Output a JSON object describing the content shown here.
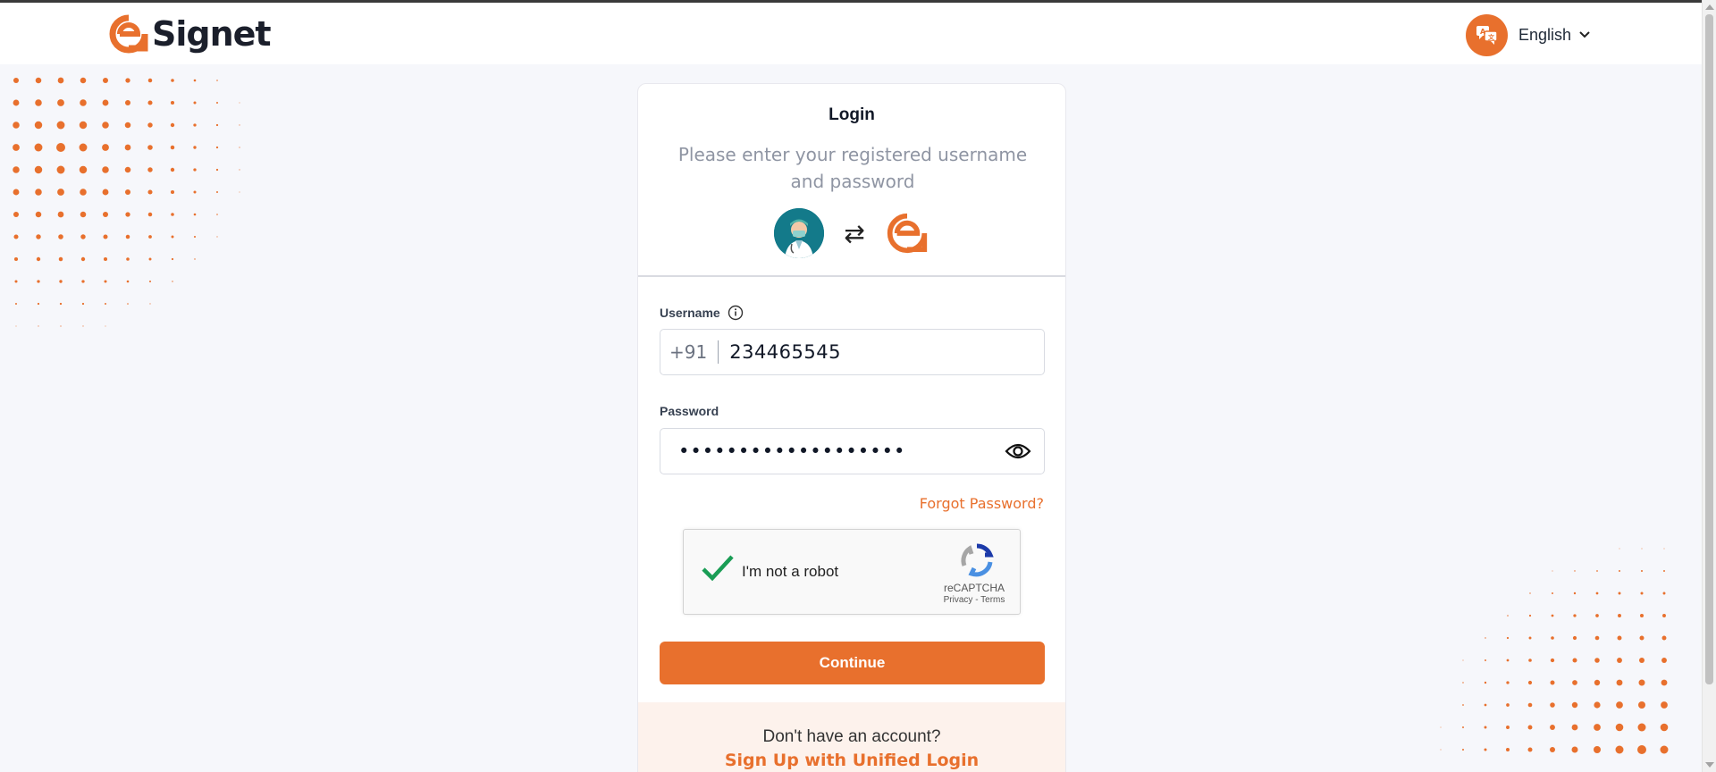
{
  "header": {
    "brand_name": "Signet",
    "language": {
      "label": "English"
    }
  },
  "login": {
    "title": "Login",
    "subtitle": "Please enter your registered username and password",
    "swap_symbol": "⇄",
    "username": {
      "label": "Username",
      "country_code": "+91",
      "value": "234465545"
    },
    "password": {
      "label": "Password",
      "masked_value": "•••••••••••••••••••"
    },
    "forgot_label": "Forgot Password?",
    "recaptcha": {
      "label": "I'm not a robot",
      "brand": "reCAPTCHA",
      "links": "Privacy - Terms"
    },
    "continue_label": "Continue",
    "signup": {
      "prompt": "Don't have an account?",
      "link_label": "Sign Up with Unified Login"
    }
  },
  "colors": {
    "accent": "#e8702d",
    "background": "#f6f7fb",
    "card": "#ffffff",
    "signup_bg": "#fdf2ec"
  },
  "icons": [
    "signet-logo-icon",
    "language-icon",
    "chevron-down-icon",
    "doctor-avatar",
    "swap-icon",
    "signet-mark-icon",
    "info-icon",
    "eye-icon",
    "checkmark-icon",
    "recaptcha-logo-icon"
  ]
}
